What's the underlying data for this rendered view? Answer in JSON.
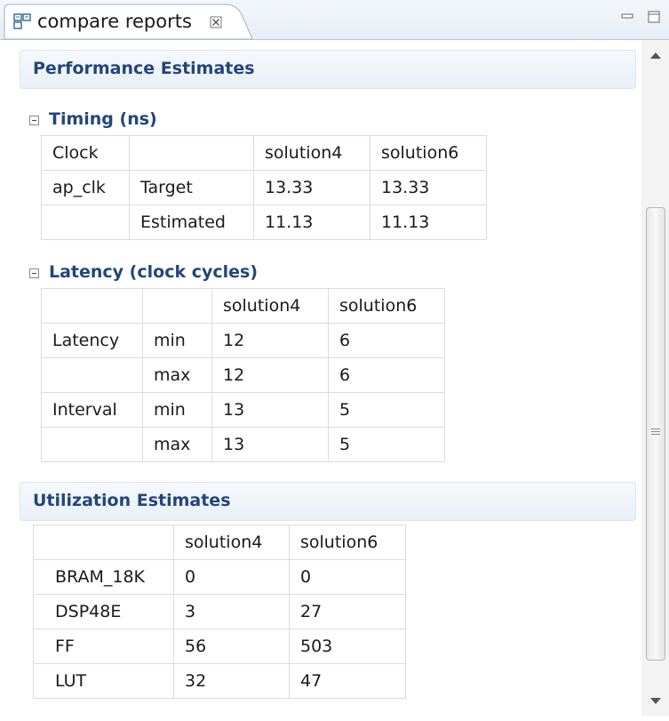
{
  "tab": {
    "label": "compare reports",
    "close_glyph": "☒"
  },
  "performance": {
    "title": "Performance Estimates",
    "timing": {
      "title": "Timing (ns)",
      "header": [
        "Clock",
        "",
        "solution4",
        "solution6"
      ],
      "rows": [
        [
          "ap_clk",
          "Target",
          "13.33",
          "13.33"
        ],
        [
          "",
          "Estimated",
          "11.13",
          "11.13"
        ]
      ]
    },
    "latency": {
      "title": "Latency (clock cycles)",
      "header": [
        "",
        "",
        "solution4",
        "solution6"
      ],
      "rows": [
        [
          "Latency",
          "min",
          "12",
          "6"
        ],
        [
          "",
          "max",
          "12",
          "6"
        ],
        [
          "Interval",
          "min",
          "13",
          "5"
        ],
        [
          "",
          "max",
          "13",
          "5"
        ]
      ]
    }
  },
  "utilization": {
    "title": "Utilization Estimates",
    "header": [
      "",
      "solution4",
      "solution6"
    ],
    "rows": [
      [
        "BRAM_18K",
        "0",
        "0"
      ],
      [
        "DSP48E",
        "3",
        "27"
      ],
      [
        "FF",
        "56",
        "503"
      ],
      [
        "LUT",
        "32",
        "47"
      ]
    ]
  },
  "colors": {
    "section_title": "#22467a",
    "tab_bg": "#f4f7fb",
    "border": "#dcdcdc"
  },
  "icons": [
    "compare-reports-icon",
    "close-tab-icon",
    "minimize-icon",
    "maximize-icon",
    "scroll-up-icon",
    "scroll-down-icon"
  ]
}
